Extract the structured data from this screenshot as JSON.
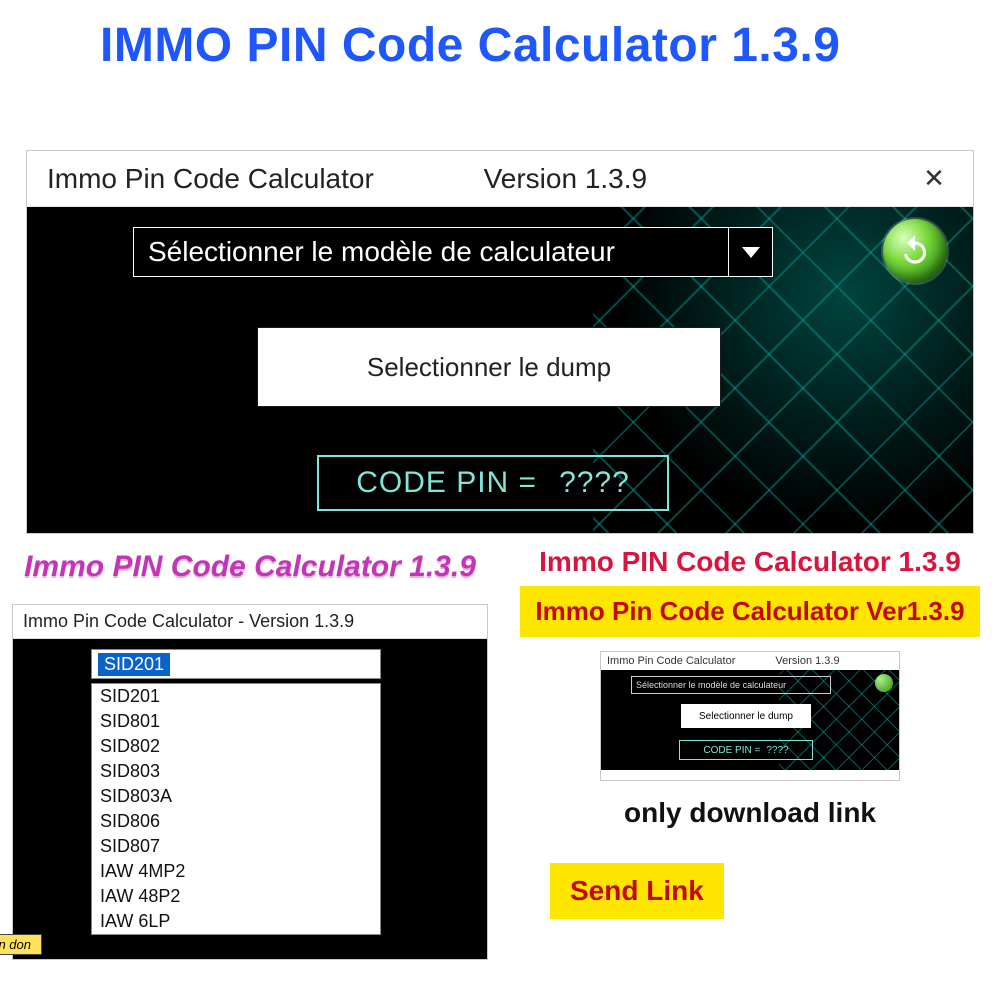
{
  "top_heading": "IMMO PIN Code Calculator 1.3.9",
  "main_window": {
    "title_left": "Immo Pin Code Calculator",
    "title_version": "Version 1.3.9",
    "combo_label": "Sélectionner le modèle de calculateur",
    "dump_button": "Selectionner le dump",
    "pin_label": "CODE PIN =",
    "pin_value": "????"
  },
  "bottom_left": {
    "heading": "Immo PIN Code Calculator 1.3.9",
    "titlebar": "Immo Pin Code Calculator  -  Version 1.3.9",
    "selected": "SID201",
    "options": [
      "SID201",
      "SID801",
      "SID802",
      "SID803",
      "SID803A",
      "SID806",
      "SID807",
      "IAW 4MP2",
      "IAW 48P2",
      "IAW 6LP"
    ],
    "donate": "Faire un don"
  },
  "bottom_right": {
    "heading": "Immo PIN Code Calculator 1.3.9",
    "band": "Immo Pin Code Calculator Ver1.3.9",
    "thumb": {
      "title_left": "Immo Pin Code Calculator",
      "title_version": "Version 1.3.9",
      "combo": "Sélectionner le modèle de calculateur",
      "dump": "Selectionner le dump",
      "pin_label": "CODE PIN =",
      "pin_value": "????"
    },
    "note": "only download link",
    "send": "Send Link"
  }
}
